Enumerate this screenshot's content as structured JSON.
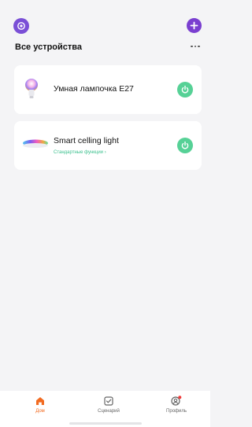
{
  "header": {
    "title": "Все устройства",
    "home_icon": "home-settings-icon",
    "add_icon": "plus-icon",
    "more_icon": "more-horizontal-icon",
    "accent_color": "#7a3fd0"
  },
  "devices": [
    {
      "name": "Умная лампочка E27",
      "icon": "bulb-icon",
      "subtitle": "",
      "power": "on"
    },
    {
      "name": "Smart celling light",
      "icon": "ceiling-light-icon",
      "subtitle": "Стандартные функции ›",
      "power": "on"
    }
  ],
  "power_color": "#56d196",
  "tabs": [
    {
      "label": "Дом",
      "icon": "home-icon",
      "active": true
    },
    {
      "label": "Сценарий",
      "icon": "checkbox-icon",
      "active": false
    },
    {
      "label": "Профиль",
      "icon": "profile-icon",
      "active": false
    }
  ],
  "active_color": "#f26b21"
}
